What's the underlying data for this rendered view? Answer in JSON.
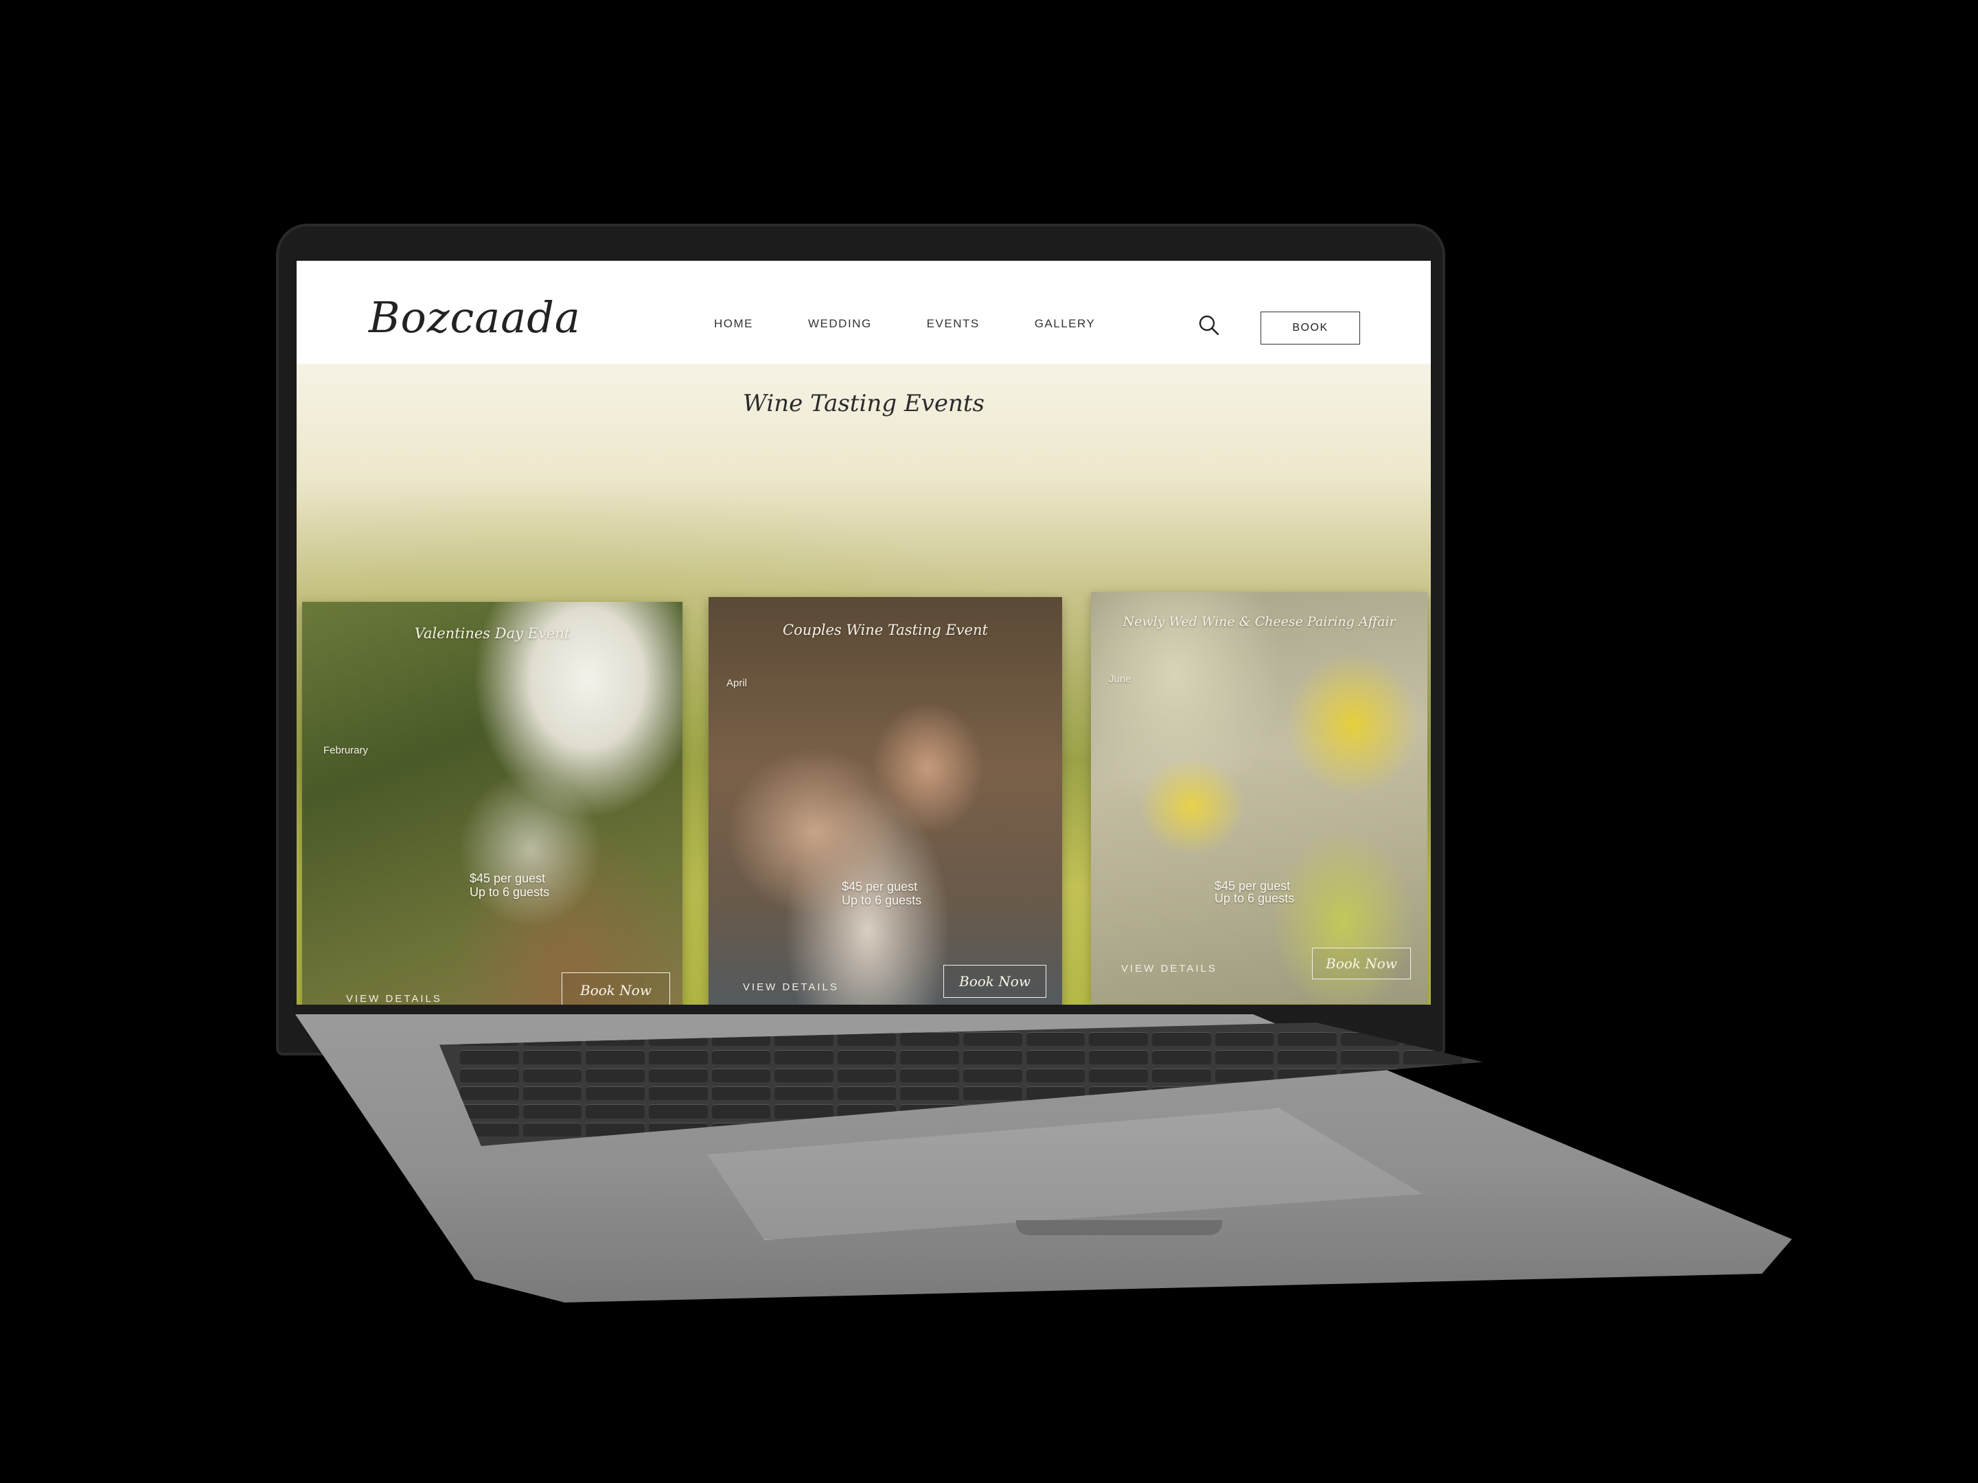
{
  "brand": {
    "logo_text": "Bozcaada"
  },
  "nav": {
    "items": [
      {
        "label": "HOME"
      },
      {
        "label": "WEDDING"
      },
      {
        "label": "EVENTS"
      },
      {
        "label": "GALLERY"
      }
    ],
    "search_icon": "search-icon",
    "book_label": "BOOK"
  },
  "hero": {
    "title": "Wine Tasting Events"
  },
  "events": [
    {
      "title": "Valentines Day Event",
      "month": "Februrary",
      "price": "$45 per guest",
      "guests": "Up to 6 guests",
      "details_label": "VIEW DETAILS",
      "book_label": "Book Now"
    },
    {
      "title": "Couples Wine Tasting Event",
      "month": "April",
      "price": "$45 per guest",
      "guests": "Up to 6 guests",
      "details_label": "VIEW DETAILS",
      "book_label": "Book Now"
    },
    {
      "title": "Newly Wed Wine & Cheese Pairing Affair",
      "month": "June",
      "price": "$45 per guest",
      "guests": "Up to 6 guests",
      "details_label": "VIEW DETAILS",
      "book_label": "Book Now"
    }
  ]
}
